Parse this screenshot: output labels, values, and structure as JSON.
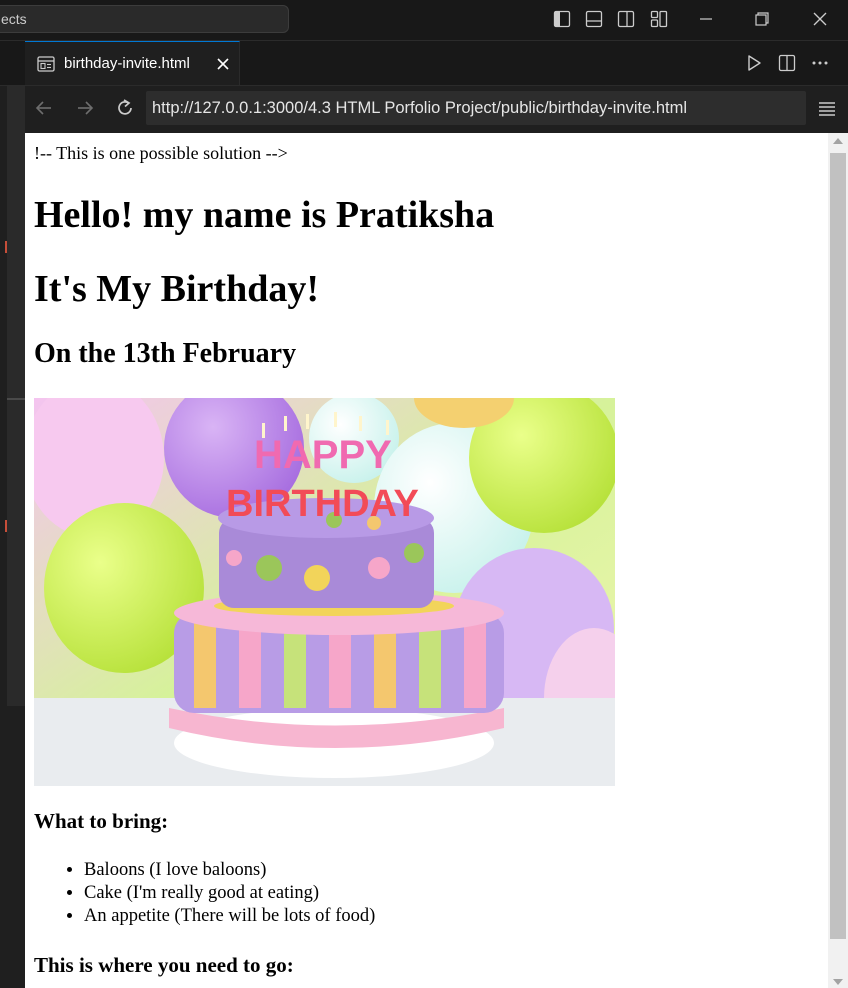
{
  "titlebar": {
    "search_text": "ects",
    "icons": [
      "toggle-primary-sidebar-icon",
      "toggle-panel-icon",
      "toggle-secondary-sidebar-icon",
      "customize-layout-icon",
      "minimize-icon",
      "restore-icon",
      "close-window-icon"
    ]
  },
  "tab": {
    "label": "birthday-invite.html"
  },
  "browser": {
    "url": "http://127.0.0.1:3000/4.3 HTML Porfolio Project/public/birthday-invite.html"
  },
  "page": {
    "comment": "!-- This is one possible solution -->",
    "heading1": "Hello! my name is Pratiksha",
    "heading2": "It's My Birthday!",
    "heading3": "On the 13th February",
    "image_alt": "birthday cake",
    "bring_heading": "What to bring:",
    "bring_items": [
      "Baloons (I love baloons)",
      "Cake (I'm really good at eating)",
      "An appetite (There will be lots of food)"
    ],
    "go_heading": "This is where you need to go:"
  },
  "colors": {
    "accent": "#0078d4",
    "chrome_bg": "#181818",
    "editor_bg": "#1f1f1f"
  }
}
